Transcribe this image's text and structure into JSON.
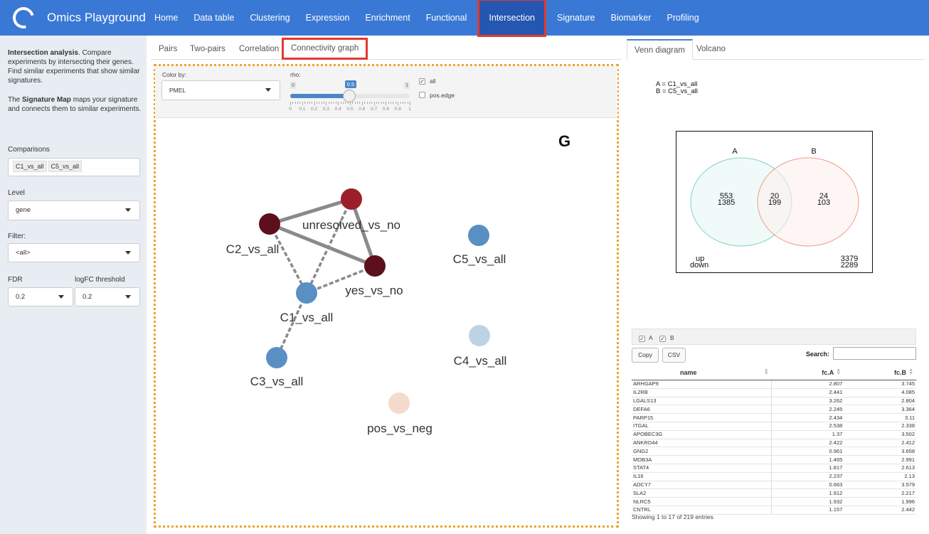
{
  "app": {
    "title": "Omics Playground"
  },
  "nav": {
    "items": [
      "Home",
      "Data table",
      "Clustering",
      "Expression",
      "Enrichment",
      "Functional",
      "Intersection",
      "Signature",
      "Biomarker",
      "Profiling"
    ],
    "active": "Intersection"
  },
  "sidebar": {
    "intro_bold": "Intersection analysis",
    "intro_rest": ". Compare experiments by intersecting their genes. Find similar experiments that show similar signatures.",
    "sigmap_pre": "The ",
    "sigmap_bold": "Signature Map",
    "sigmap_rest": " maps your signature and connects them to similar experiments.",
    "comparisons_label": "Comparisons",
    "comparisons": [
      "C1_vs_all",
      "C5_vs_all"
    ],
    "level_label": "Level",
    "level_value": "gene",
    "filter_label": "Filter:",
    "filter_value": "<all>",
    "fdr_label": "FDR",
    "fdr_value": "0.2",
    "logfc_label": "logFC threshold",
    "logfc_value": "0.2"
  },
  "main_tabs": [
    "Pairs",
    "Two-pairs",
    "Correlation",
    "Connectivity graph"
  ],
  "main_active_tab": "Connectivity graph",
  "controls": {
    "color_by_label": "Color by:",
    "color_by_value": "PMEL",
    "rho_label": "rho:",
    "rho_min": "0",
    "rho_max": "1",
    "rho_value": "0.5",
    "rho_ticks": [
      "0",
      "0.1",
      "0.2",
      "0.3",
      "0.4",
      "0.5",
      "0.6",
      "0.7",
      "0.8",
      "0.9",
      "1"
    ],
    "all_label": "all",
    "all_checked": true,
    "posedge_label": "pos.edge",
    "posedge_checked": false
  },
  "graph": {
    "panel_letter": "G",
    "nodes": [
      {
        "id": "unresolved_vs_no",
        "label": "unresolved_vs_no",
        "color": "#9b1f2a"
      },
      {
        "id": "C2_vs_all",
        "label": "C2_vs_all",
        "color": "#5e0f1c"
      },
      {
        "id": "yes_vs_no",
        "label": "yes_vs_no",
        "color": "#5e0f1c"
      },
      {
        "id": "C1_vs_all",
        "label": "C1_vs_all",
        "color": "#5a8fc4"
      },
      {
        "id": "C3_vs_all",
        "label": "C3_vs_all",
        "color": "#5a8fc4"
      },
      {
        "id": "C5_vs_all",
        "label": "C5_vs_all",
        "color": "#5a8fc4"
      },
      {
        "id": "C4_vs_all",
        "label": "C4_vs_all",
        "color": "#bcd3e6"
      },
      {
        "id": "pos_vs_neg",
        "label": "pos_vs_neg",
        "color": "#f3dccc"
      }
    ],
    "edges": [
      {
        "from": "C2_vs_all",
        "to": "unresolved_vs_no",
        "style": "solid"
      },
      {
        "from": "C2_vs_all",
        "to": "yes_vs_no",
        "style": "solid"
      },
      {
        "from": "unresolved_vs_no",
        "to": "yes_vs_no",
        "style": "solid"
      },
      {
        "from": "C2_vs_all",
        "to": "C1_vs_all",
        "style": "dashed"
      },
      {
        "from": "unresolved_vs_no",
        "to": "C1_vs_all",
        "style": "dashed"
      },
      {
        "from": "yes_vs_no",
        "to": "C1_vs_all",
        "style": "dashed"
      },
      {
        "from": "C1_vs_all",
        "to": "C3_vs_all",
        "style": "dashed"
      }
    ]
  },
  "right_tabs": [
    "Venn diagram",
    "Volcano"
  ],
  "right_active_tab": "Venn diagram",
  "venn": {
    "legend": [
      "A = C1_vs_all",
      "B = C5_vs_all"
    ],
    "set_a": "A",
    "set_b": "B",
    "a_only_up": "553",
    "a_only_down": "1385",
    "both_up": "20",
    "both_down": "199",
    "b_only_up": "24",
    "b_only_down": "103",
    "corner_up": "up",
    "corner_down": "down",
    "outside_up": "3379",
    "outside_down": "2289"
  },
  "table": {
    "filters": [
      {
        "label": "A",
        "checked": true
      },
      {
        "label": "B",
        "checked": true
      }
    ],
    "copy_label": "Copy",
    "csv_label": "CSV",
    "search_label": "Search:",
    "columns": [
      "name",
      "fc.A",
      "fc.B"
    ],
    "rows": [
      [
        "ARHGAP9",
        "2.807",
        "3.745"
      ],
      [
        "IL2RB",
        "2.441",
        "4.085"
      ],
      [
        "LGALS13",
        "3.262",
        "2.804"
      ],
      [
        "DEFA6",
        "2.245",
        "3.364"
      ],
      [
        "PARP15",
        "2.434",
        "3.11"
      ],
      [
        "ITGAL",
        "2.538",
        "2.338"
      ],
      [
        "APOBEC3G",
        "1.37",
        "3.502"
      ],
      [
        "ANKRD44",
        "2.422",
        "2.412"
      ],
      [
        "GNG2",
        "0.961",
        "3.658"
      ],
      [
        "MOB3A",
        "1.465",
        "2.991"
      ],
      [
        "STAT4",
        "1.817",
        "2.613"
      ],
      [
        "IL16",
        "2.237",
        "2.13"
      ],
      [
        "ADCY7",
        "0.663",
        "3.579"
      ],
      [
        "SLA2",
        "1.912",
        "2.217"
      ],
      [
        "NLRC5",
        "1.932",
        "1.996"
      ],
      [
        "CNTRL",
        "1.157",
        "2.442"
      ]
    ],
    "info": "Showing 1 to 17 of 219 entries"
  }
}
